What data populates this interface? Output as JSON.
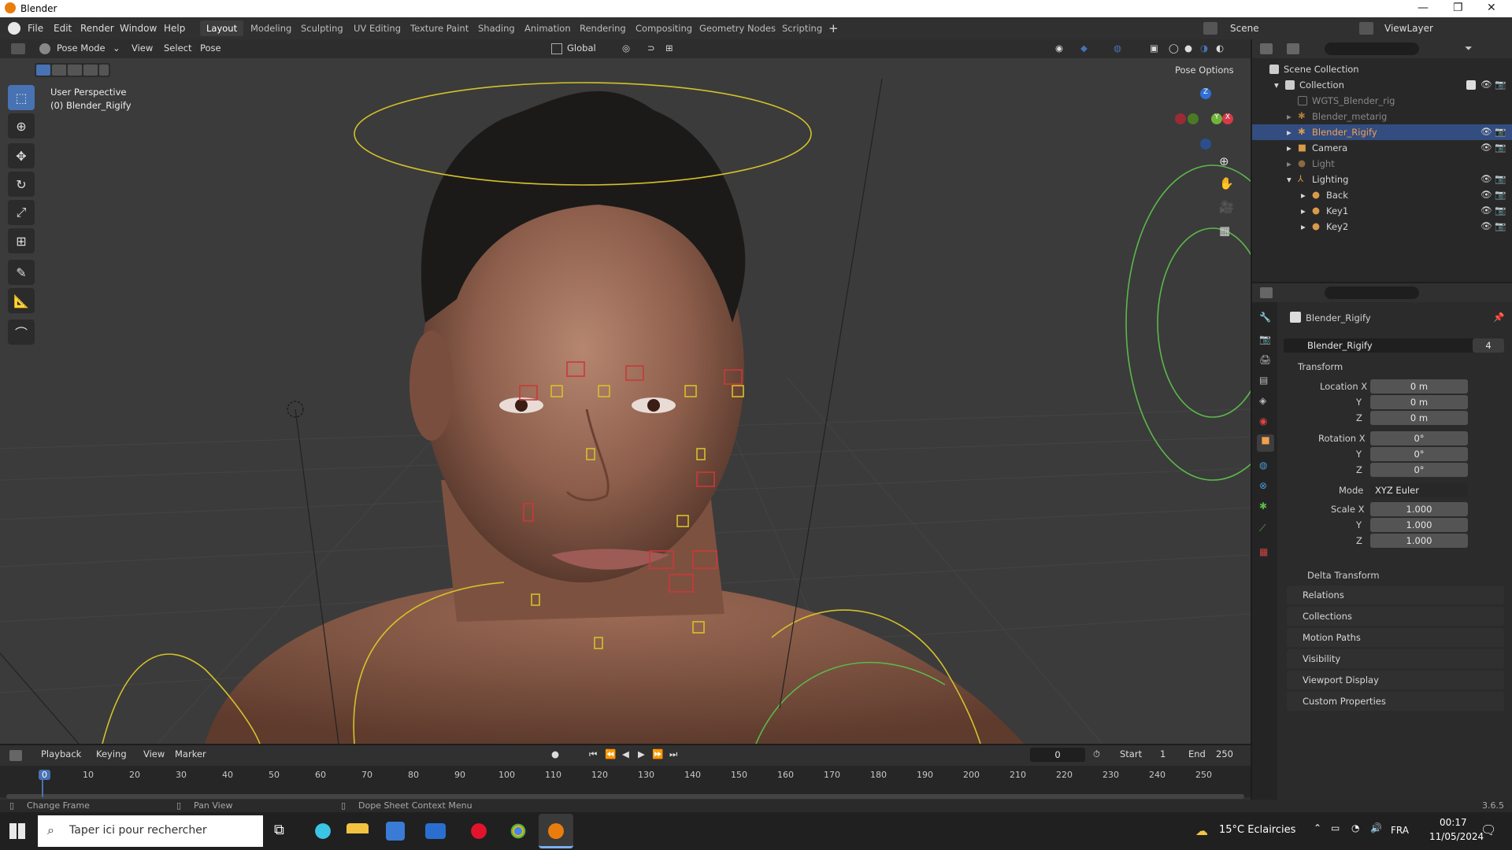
{
  "window": {
    "title": "Blender"
  },
  "menu": {
    "items": [
      "File",
      "Edit",
      "Render",
      "Window",
      "Help"
    ]
  },
  "workspaces": [
    "Layout",
    "Modeling",
    "Sculpting",
    "UV Editing",
    "Texture Paint",
    "Shading",
    "Animation",
    "Rendering",
    "Compositing",
    "Geometry Nodes",
    "Scripting"
  ],
  "active_workspace": "Layout",
  "scene": {
    "name": "Scene",
    "view_layer": "ViewLayer"
  },
  "viewport": {
    "mode": "Pose Mode",
    "menus": [
      "View",
      "Select",
      "Pose"
    ],
    "orientation": "Global",
    "perspective": "User Perspective",
    "object": "(0) Blender_Rigify",
    "pose_options": "Pose Options"
  },
  "outliner": {
    "root": "Scene Collection",
    "collection": "Collection",
    "items": [
      "WGTS_Blender_rig",
      "Blender_metarig",
      "Blender_Rigify",
      "Camera",
      "Light",
      "Lighting",
      "Back",
      "Key1",
      "Key2"
    ],
    "selected": "Blender_Rigify"
  },
  "properties": {
    "object_name": "Blender_Rigify",
    "data_name": "Blender_Rigify",
    "users": "4",
    "transform_label": "Transform",
    "location_label": "Location X",
    "rotation_label": "Rotation X",
    "scale_label": "Scale X",
    "y_label": "Y",
    "z_label": "Z",
    "location": [
      "0 m",
      "0 m",
      "0 m"
    ],
    "rotation": [
      "0°",
      "0°",
      "0°"
    ],
    "mode_label": "Mode",
    "mode": "XYZ Euler",
    "scale": [
      "1.000",
      "1.000",
      "1.000"
    ],
    "delta": "Delta Transform",
    "panels": [
      "Relations",
      "Collections",
      "Motion Paths",
      "Visibility",
      "Viewport Display",
      "Custom Properties"
    ]
  },
  "timeline": {
    "menus": [
      "Playback",
      "Keying",
      "View",
      "Marker"
    ],
    "current_frame": "0",
    "start_label": "Start",
    "start": "1",
    "end_label": "End",
    "end": "250",
    "ticks": [
      "0",
      "10",
      "20",
      "30",
      "40",
      "50",
      "60",
      "70",
      "80",
      "90",
      "100",
      "110",
      "120",
      "130",
      "140",
      "150",
      "160",
      "170",
      "180",
      "190",
      "200",
      "210",
      "220",
      "230",
      "240",
      "250"
    ]
  },
  "statusbar": {
    "change_frame": "Change Frame",
    "pan_view": "Pan View",
    "context_menu": "Dope Sheet Context Menu",
    "version": "3.6.5"
  },
  "taskbar": {
    "search_placeholder": "Taper ici pour rechercher",
    "weather": "15°C  Eclaircies",
    "lang": "FRA",
    "time": "00:17",
    "date": "11/05/2024"
  },
  "colors": {
    "accent": "#4772b3",
    "selected_row": "#334d80",
    "bone_yellow": "#d4c12a",
    "bone_red": "#c83a3a",
    "bone_green": "#5bb84a"
  }
}
